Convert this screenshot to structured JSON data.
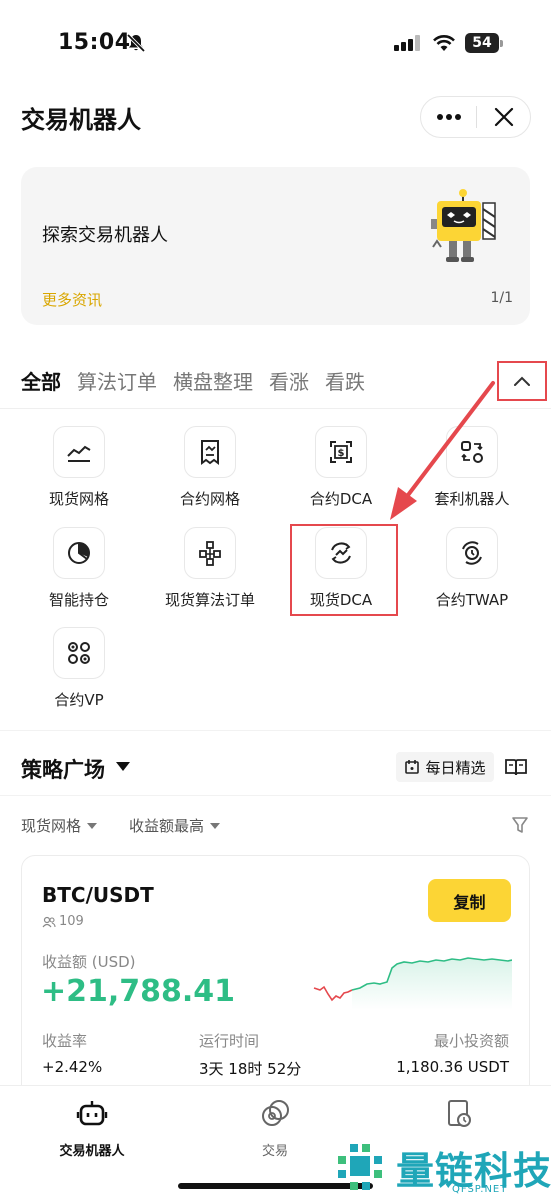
{
  "status": {
    "time": "15:04",
    "battery": "54"
  },
  "header": {
    "title": "交易机器人"
  },
  "banner": {
    "title": "探索交易机器人",
    "more": "更多资讯",
    "page": "1/1"
  },
  "tabs": [
    {
      "label": "全部",
      "active": true
    },
    {
      "label": "算法订单"
    },
    {
      "label": "横盘整理"
    },
    {
      "label": "看涨"
    },
    {
      "label": "看跌"
    }
  ],
  "grid": [
    {
      "label": "现货网格",
      "icon": "chart-line-icon"
    },
    {
      "label": "合约网格",
      "icon": "document-icon"
    },
    {
      "label": "合约DCA",
      "icon": "dollar-doc-icon"
    },
    {
      "label": "套利机器人",
      "icon": "arbitrage-icon"
    },
    {
      "label": "智能持仓",
      "icon": "pie-chart-icon"
    },
    {
      "label": "现货算法订单",
      "icon": "nodes-icon"
    },
    {
      "label": "现货DCA",
      "icon": "refresh-trend-icon"
    },
    {
      "label": "合约TWAP",
      "icon": "clock-cycle-icon"
    },
    {
      "label": "合约VP",
      "icon": "dots-grid-icon"
    }
  ],
  "strategy": {
    "title": "策略广场",
    "daily_pick": "每日精选",
    "filter_type": "现货网格",
    "filter_sort": "收益额最高"
  },
  "card": {
    "pair": "BTC/USDT",
    "copies": "109",
    "copy_label": "复制",
    "pnl_label": "收益额 (USD)",
    "pnl_value": "+21,788.41",
    "roi_label": "收益率",
    "roi_value": "+2.42%",
    "runtime_label": "运行时间",
    "runtime_value": "3天 18时 52分",
    "min_label": "最小投资额",
    "min_value": "1,180.36 USDT"
  },
  "nav": [
    {
      "label": "交易机器人",
      "active": true
    },
    {
      "label": "交易"
    },
    {
      "label": ""
    }
  ],
  "watermark": {
    "text": "量链科技",
    "sub": "QFSP.NET"
  },
  "colors": {
    "accent": "#fcd535",
    "profit": "#2ebd85",
    "loss": "#e5484d",
    "highlight": "#e5484d"
  }
}
